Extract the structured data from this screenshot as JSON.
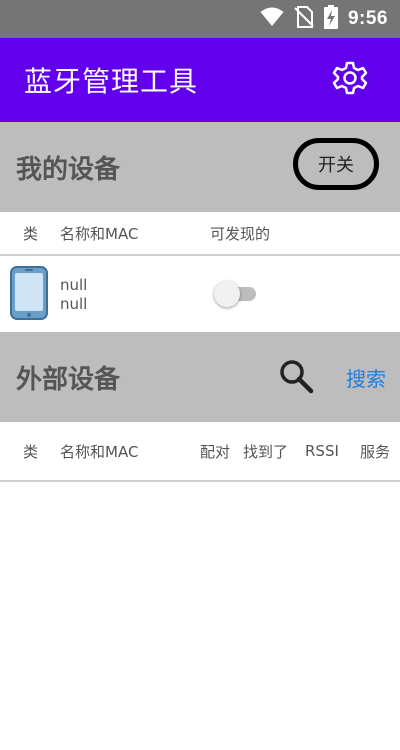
{
  "status_bar": {
    "time": "9:56",
    "icons": [
      "wifi-icon",
      "no-sim-icon",
      "battery-charging-icon"
    ]
  },
  "app_bar": {
    "title": "蓝牙管理工具",
    "settings_icon": "gear-icon",
    "color": "#6200ee"
  },
  "my_devices": {
    "title": "我的设备",
    "toggle_label": "开关",
    "columns": [
      "类",
      "名称和MAC",
      "可发现的"
    ],
    "device": {
      "icon": "phone-icon",
      "name": "null",
      "mac": "null",
      "discoverable": false
    }
  },
  "external_devices": {
    "title": "外部设备",
    "search_icon": "search-icon",
    "search_label": "搜索",
    "columns": [
      "类",
      "名称和MAC",
      "配对",
      "找到了",
      "RSSI",
      "服务"
    ]
  }
}
